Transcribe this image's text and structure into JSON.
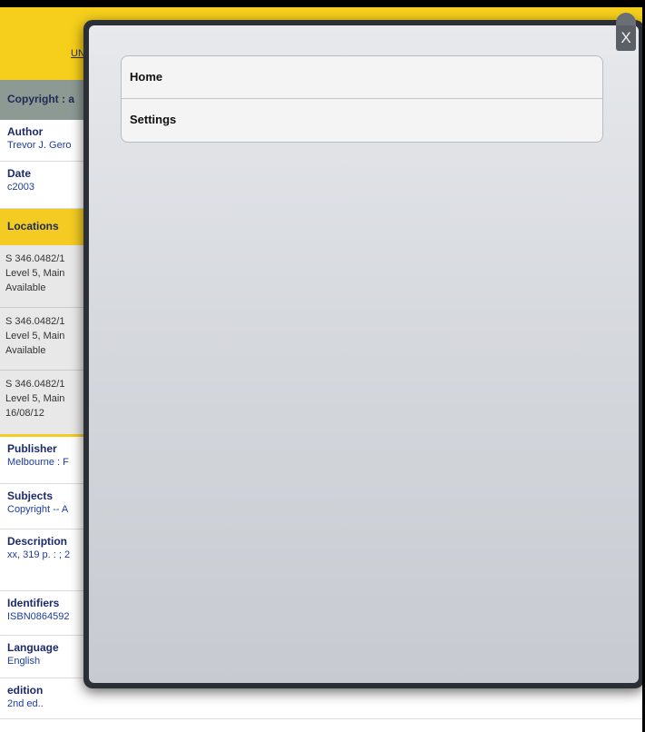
{
  "header": {
    "link_text": "UN"
  },
  "copyright_bar": {
    "text": "Copyright : a"
  },
  "fields": [
    {
      "label": "Author",
      "value": "Trevor J. Gero"
    },
    {
      "label": "Date",
      "value": "c2003"
    }
  ],
  "locations": {
    "title": "Locations",
    "items": [
      {
        "call_number": "S 346.0482/1",
        "location": "Level 5, Main",
        "status": "Available"
      },
      {
        "call_number": "S 346.0482/1",
        "location": "Level 5, Main",
        "status": "Available"
      },
      {
        "call_number": "S 346.0482/1",
        "location": "Level 5, Main",
        "status": "16/08/12"
      }
    ]
  },
  "details": [
    {
      "label": "Publisher",
      "value": "Melbourne : F"
    },
    {
      "label": "Subjects",
      "value": "Copyright -- A"
    },
    {
      "label": "Description",
      "value": "xx, 319 p. : ; 2"
    },
    {
      "label": "Identifiers",
      "value": "ISBN0864592"
    },
    {
      "label": "Language",
      "value": "English"
    },
    {
      "label": "edition",
      "value": "2nd ed.."
    }
  ],
  "modal": {
    "close_label": "X",
    "menu": [
      {
        "label": "Home"
      },
      {
        "label": "Settings"
      }
    ]
  },
  "colors": {
    "header_yellow": "#f6cf1c",
    "copyright_gray": "#8d9a94",
    "label_navy": "#1c2a6b",
    "value_blue": "#1e3c9b",
    "modal_frame": "#2b2f36"
  }
}
